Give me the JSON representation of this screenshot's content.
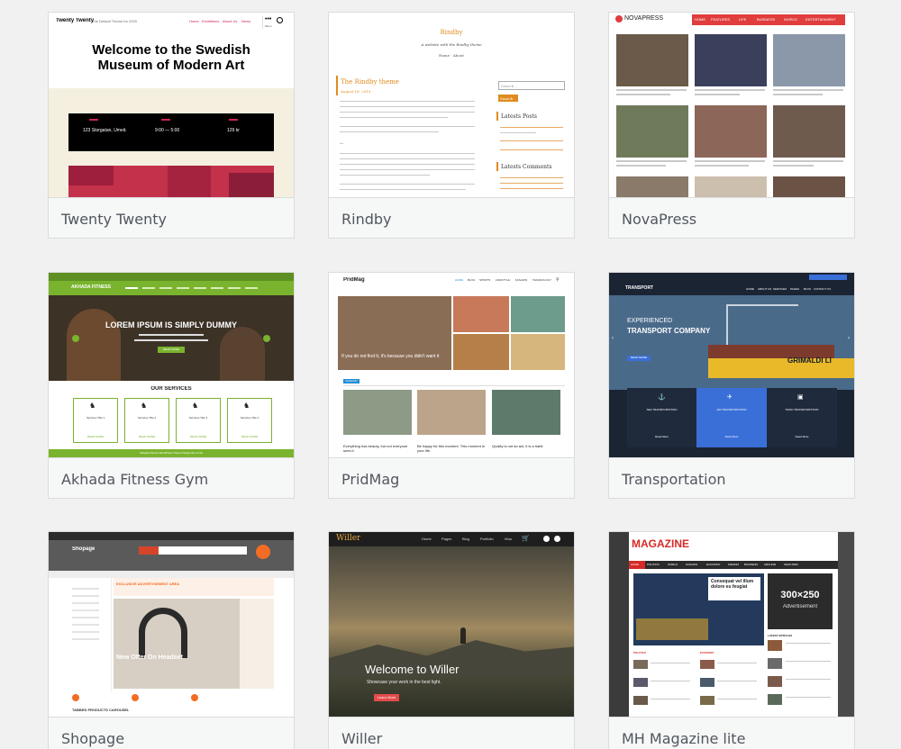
{
  "themes": [
    {
      "name": "Twenty Twenty",
      "preview": {
        "site_title": "Twenty Twenty",
        "tagline": "The Default Theme for 2020",
        "menu": [
          "Home",
          "Exhibitions",
          "About Us",
          "News"
        ],
        "menu_more": "Menu",
        "headline": "Welcome to the Swedish Museum of Modern Art",
        "info": [
          "123 Storgatan, Umeå",
          "9:00 — 5:00",
          "129 kr"
        ]
      }
    },
    {
      "name": "Rindby",
      "preview": {
        "site_title": "Rindby",
        "tagline": "A website with the Rindby theme",
        "nav": "Home · About",
        "post_title": "The Rindby theme",
        "post_date": "August 18, 2019",
        "search_placeholder": "Search ...",
        "search_button": "Search",
        "sidebar_latest_posts": "Latests Posts",
        "sidebar_latest_comments": "Latests Comments"
      }
    },
    {
      "name": "NovaPress",
      "preview": {
        "logo": "NOVAPRESS",
        "nav": [
          "HOME",
          "FEATURES",
          "LIFE",
          "BUSINESS",
          "WORLD",
          "ENTERTAINMENT"
        ]
      }
    },
    {
      "name": "Akhada Fitness Gym",
      "preview": {
        "brand": "AKHADA FITNESS",
        "hero": "LOREM IPSUM IS SIMPLY DUMMY",
        "hero_button": "READ MORE",
        "services_title": "OUR SERVICES",
        "services": [
          "Services Title 1",
          "Services Title 2",
          "Services Title 3",
          "Services Title 4"
        ],
        "read_more": "READ MORE",
        "footer": "Akhada Fitness WordPress Theme Design By Luzuk"
      }
    },
    {
      "name": "PridMag",
      "preview": {
        "logo": "PridMag",
        "nav": [
          "HOME",
          "BLOG",
          "SPORTS",
          "LIFESTYLE",
          "FASHION",
          "TECHNOLOGY"
        ],
        "feature_caption": "If you do not find it, it's because you didn't want it",
        "section_tag": "FASHION",
        "captions": [
          "Everything has beauty, but not everyone sees it.",
          "Be happy for this moment. This moment is your life.",
          "Quality is not an act, it is a habit"
        ]
      }
    },
    {
      "name": "Transportation",
      "preview": {
        "logo": "TRANSPORT",
        "nav": [
          "HOME",
          "ABOUT US",
          "SERVICES",
          "PAGES",
          "BLOG",
          "CONTACT US"
        ],
        "hero_small": "EXPERIENCED",
        "hero_big": "TRANSPORT COMPANY",
        "hero_button": "READ MORE",
        "ship_text": "GRIMALDI LI",
        "services": [
          "SEA TRANSPORTATION",
          "AIR TRANSPORTATION",
          "TRAIN TRANSPORTATION"
        ],
        "read_more": "Read More"
      }
    },
    {
      "name": "Shopage",
      "preview": {
        "logo": "Shopage",
        "banner_title": "EXCLUSIVE ADVERTISEMENT AREA",
        "offer": "New Offer On Headset",
        "tabbed": "TABBED PRODUCTS CAROUSEL"
      }
    },
    {
      "name": "Willer",
      "preview": {
        "logo": "Willer",
        "nav": [
          "Home",
          "Pages",
          "Blog",
          "Portfolio",
          "Woo"
        ],
        "headline": "Welcome to Willer",
        "subline": "Showcase your work in the best light.",
        "button": "Learn More"
      }
    },
    {
      "name": "MH Magazine lite",
      "preview": {
        "logo": "MAGAZINE",
        "nav": [
          "HOME",
          "POLITICS",
          "WORLD",
          "FASHION",
          "ECONOMY",
          "MARKET",
          "BUSINESS",
          "ARCHIVE",
          "FEATURES"
        ],
        "slide_caption": "Consequat vel illum dolore eu feugiat",
        "ad_size": "300×250",
        "ad_label": "Advertisement",
        "latest": "LATEST ARTICLES",
        "sections": [
          "POLITICS",
          "ECONOMY"
        ]
      }
    }
  ],
  "colors": {
    "accent_orange": "#f36c24",
    "fitness_green": "#7ab32e",
    "novapress_red": "#e03d3d",
    "transport_blue": "#3a6fd8",
    "magazine_red": "#d62a27"
  }
}
